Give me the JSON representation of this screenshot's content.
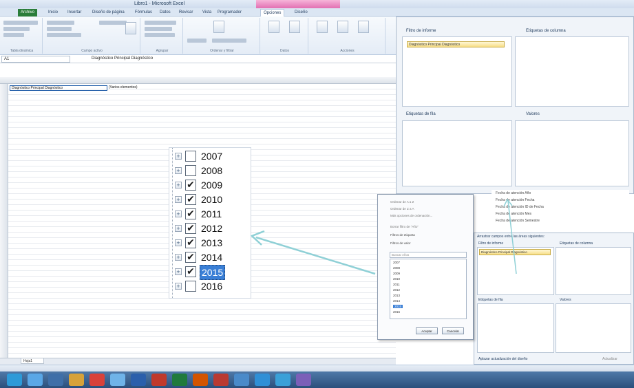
{
  "window": {
    "title": "Libro1 - Microsoft Excel"
  },
  "ribbon": {
    "tabs": [
      "Archivo",
      "Inicio",
      "Insertar",
      "Diseño de página",
      "Fórmulas",
      "Datos",
      "Revisar",
      "Vista",
      "Programador",
      "Opciones",
      "Diseño"
    ],
    "groups": [
      "Tabla dinámica",
      "Campo activo",
      "Agrupar",
      "Ordenar y filtrar",
      "Datos",
      "Acciones"
    ]
  },
  "formula_bar": {
    "cell_ref": "A1",
    "formula": "Diagnóstico Principal Diagnóstico"
  },
  "sheet": {
    "cell_a1": "Diagnóstico Principal Diagnóstico",
    "cell_b1": "(Varios elementos)",
    "tab": "Hoja1"
  },
  "year_filter": {
    "items": [
      {
        "label": "2007",
        "checked": false
      },
      {
        "label": "2008",
        "checked": false
      },
      {
        "label": "2009",
        "checked": true
      },
      {
        "label": "2010",
        "checked": true
      },
      {
        "label": "2011",
        "checked": true
      },
      {
        "label": "2012",
        "checked": true
      },
      {
        "label": "2013",
        "checked": true
      },
      {
        "label": "2014",
        "checked": true
      },
      {
        "label": "2015",
        "checked": true,
        "selected": true
      },
      {
        "label": "2016",
        "checked": false
      }
    ]
  },
  "pivot_fields": {
    "filter_header": "Filtro de informe",
    "columns_header": "Etiquetas de columna",
    "rows_header": "Etiquetas de fila",
    "values_header": "Valores",
    "filter_chip": "Diagnóstico Principal Diagnóstico",
    "drag_hint": "Arrastrar campos entre las áreas siguientes:",
    "defer_update": "Aplazar actualización del diseño",
    "update_button": "Actualizar"
  },
  "field_checks": [
    "Fecha de atención Año",
    "Fecha de atención Fecha",
    "Fecha de atención ID de Fecha",
    "Fecha de atención Mes",
    "Fecha de atención Semestre"
  ],
  "filter_popup": {
    "menu": [
      "Ordenar de A a Z",
      "Ordenar de Z a A",
      "Más opciones de ordenación...",
      "Borrar filtro de \"Año\"",
      "Filtros de etiqueta",
      "Filtros de valor"
    ],
    "search_placeholder": "Buscar Años",
    "list": [
      "2007",
      "2008",
      "2009",
      "2010",
      "2011",
      "2012",
      "2013",
      "2014",
      "2015",
      "2016"
    ],
    "ok": "Aceptar",
    "cancel": "Cancelar"
  },
  "colors": {
    "accent": "#3a7fd6",
    "arrow": "#8fd0d6",
    "context_tab": "#e26fb2"
  }
}
